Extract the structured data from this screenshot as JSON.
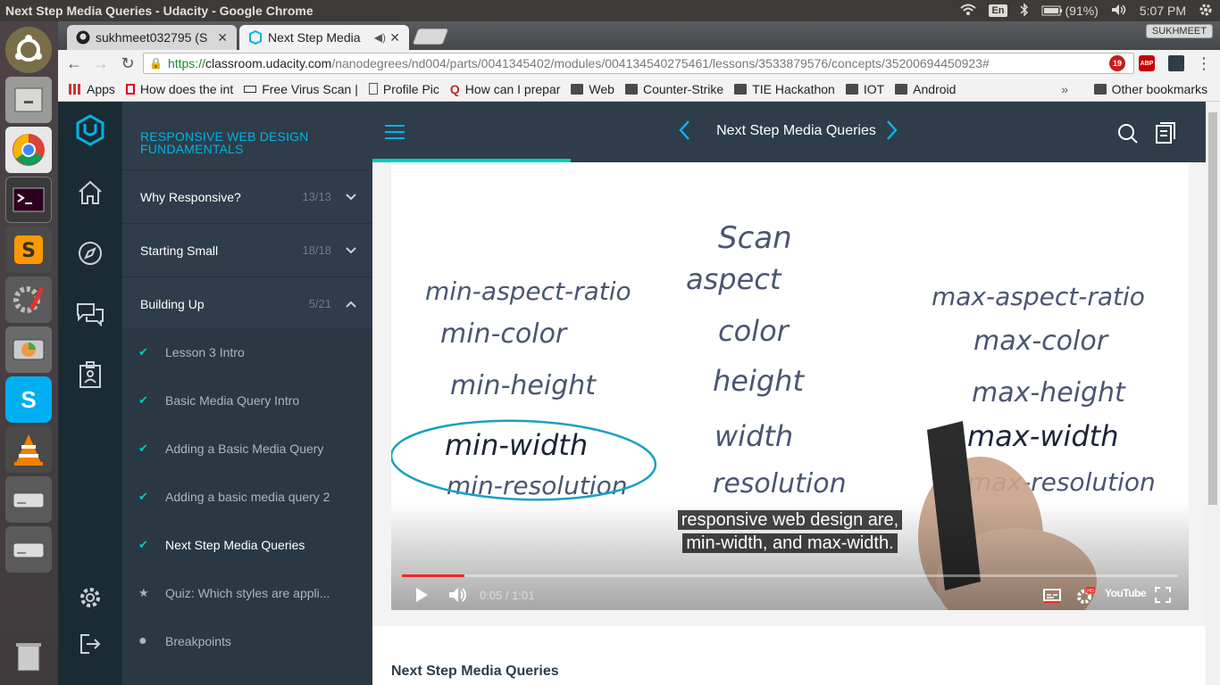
{
  "os_panel": {
    "window_title": "Next Step Media Queries - Udacity - Google Chrome",
    "keyboard": "En",
    "battery": "(91%)",
    "time": "5:07 PM"
  },
  "browser": {
    "tabs": [
      {
        "label": "sukhmeet032795 (S"
      },
      {
        "label": "Next Step Media"
      }
    ],
    "profile": "SUKHMEET",
    "url_scheme": "https://",
    "url_host": "classroom.udacity.com",
    "url_path": "/nanodegrees/nd004/parts/0041345402/modules/004134540275461/lessons/3533879576/concepts/35200694450923#",
    "ext_badge_1": "19",
    "ext_badge_2": "19",
    "ext_abp": "ABP",
    "bookmarks": [
      {
        "label": "Apps",
        "type": "apps"
      },
      {
        "label": "How does the int",
        "type": "page"
      },
      {
        "label": "Free Virus Scan |",
        "type": "page"
      },
      {
        "label": "Profile Pic",
        "type": "doc"
      },
      {
        "label": "How can I prepar",
        "type": "quora"
      },
      {
        "label": "Web",
        "type": "folder"
      },
      {
        "label": "Counter-Strike",
        "type": "folder"
      },
      {
        "label": "TIE Hackathon",
        "type": "folder"
      },
      {
        "label": "IOT",
        "type": "folder"
      },
      {
        "label": "Android",
        "type": "folder"
      }
    ],
    "bookmarks_more": "»",
    "other_bookmarks": "Other bookmarks"
  },
  "sidebar": {
    "course_title": "RESPONSIVE WEB DESIGN FUNDAMENTALS",
    "sections": [
      {
        "label": "Why Responsive?",
        "count": "13/13",
        "chevron": "down"
      },
      {
        "label": "Starting Small",
        "count": "18/18",
        "chevron": "down"
      },
      {
        "label": "Building Up",
        "count": "5/21",
        "chevron": "up"
      }
    ],
    "items": [
      {
        "label": "Lesson 3 Intro",
        "status": "done"
      },
      {
        "label": "Basic Media Query Intro",
        "status": "done"
      },
      {
        "label": "Adding a Basic Media Query",
        "status": "done"
      },
      {
        "label": "Adding a basic media query 2",
        "status": "done"
      },
      {
        "label": "Next Step Media Queries",
        "status": "current"
      },
      {
        "label": "Quiz: Which styles are appli...",
        "status": "quiz"
      },
      {
        "label": "Breakpoints",
        "status": "todo"
      }
    ]
  },
  "topbar": {
    "title": "Next Step Media Queries"
  },
  "video": {
    "board_text": {
      "top": "Scan",
      "left": [
        "min-aspect-ratio",
        "min-color",
        "min-height",
        "min-width",
        "min-resolution"
      ],
      "middle": [
        "aspect",
        "color",
        "height",
        "width",
        "resolution"
      ],
      "right": [
        "max-aspect-ratio",
        "max-color",
        "max-height",
        "max-width",
        "max-resolution"
      ]
    },
    "caption_line1": "responsive web design are,",
    "caption_line2": "min-width, and max-width.",
    "current_time": "0:05",
    "duration": "1:01",
    "time_display": "0:05 / 1:01",
    "progress_fraction": 0.08,
    "youtube_label": "YouTube",
    "hd_badge": "HD"
  },
  "concept_heading": "Next Step Media Queries",
  "colors": {
    "udacity_blue": "#02b3e4",
    "udacity_teal": "#02ccba",
    "sidebar_bg": "#2e3d49",
    "rail_bg": "#1b2b34",
    "marker_blue": "#1a9fc4",
    "progress_red": "#f12b24"
  }
}
